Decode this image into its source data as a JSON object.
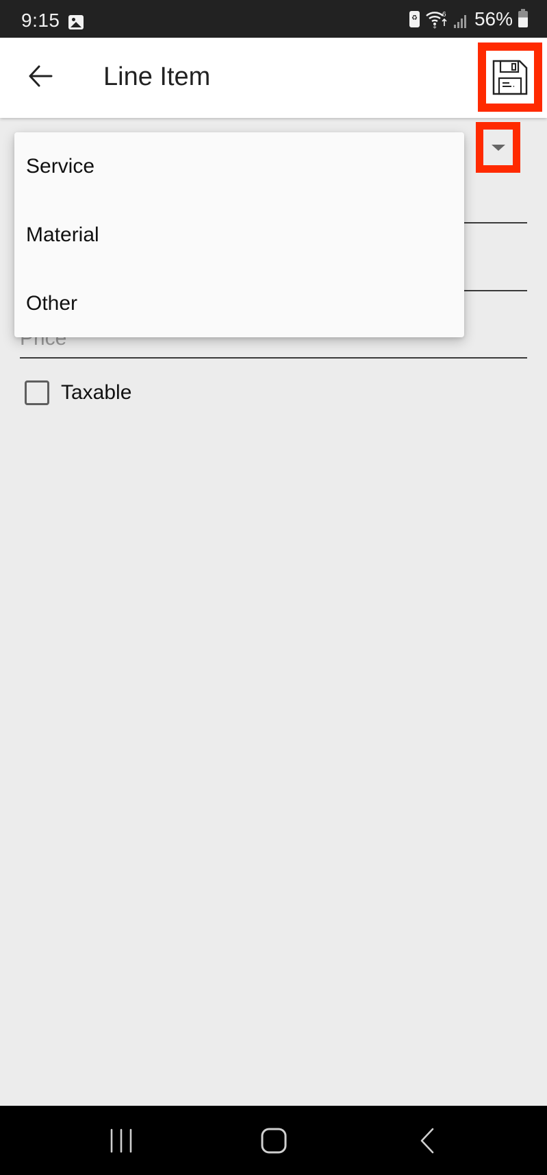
{
  "status_bar": {
    "time": "9:15",
    "battery_percent": "56%",
    "icons": [
      "gallery-icon",
      "battery-saver-icon",
      "wifi-6-icon",
      "signal-icon",
      "battery-icon"
    ]
  },
  "app_bar": {
    "title": "Line Item",
    "back_icon": "arrow-left-icon",
    "save_icon": "floppy-disk-icon"
  },
  "form": {
    "type_dropdown": {
      "arrow_icon": "caret-down-icon",
      "expanded": true,
      "options": [
        "Service",
        "Material",
        "Other"
      ]
    },
    "price_placeholder": "Price",
    "taxable": {
      "label": "Taxable",
      "checked": false
    }
  },
  "highlight_color": "#ff2a00",
  "nav_bar": {
    "buttons": [
      "recents-icon",
      "home-icon",
      "back-icon"
    ]
  }
}
